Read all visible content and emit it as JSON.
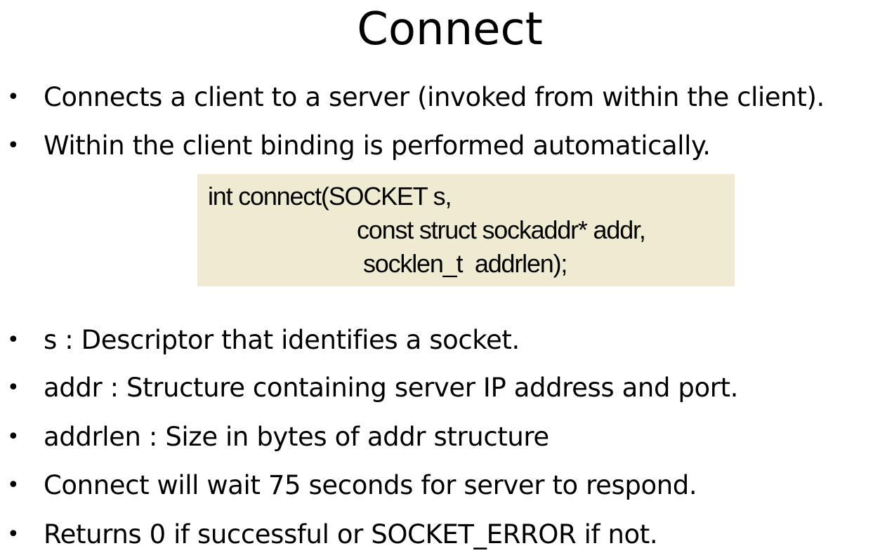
{
  "slide": {
    "title": "Connect",
    "bullets_top": [
      "Connects a client to a server (invoked from within the client).",
      "Within the client binding is performed automatically."
    ],
    "code": {
      "lines": [
        "int connect(SOCKET s,",
        "const struct sockaddr* addr,",
        "socklen_t  addrlen);"
      ],
      "background": "#eeebd2"
    },
    "bullets_bottom": [
      "s : Descriptor that identifies a socket.",
      "addr : Structure containing server IP address and port.",
      "addrlen : Size in bytes of addr structure",
      "Connect will wait 75 seconds for server to respond.",
      "Returns 0 if successful or SOCKET_ERROR if not."
    ],
    "bullet_symbol": "•"
  }
}
